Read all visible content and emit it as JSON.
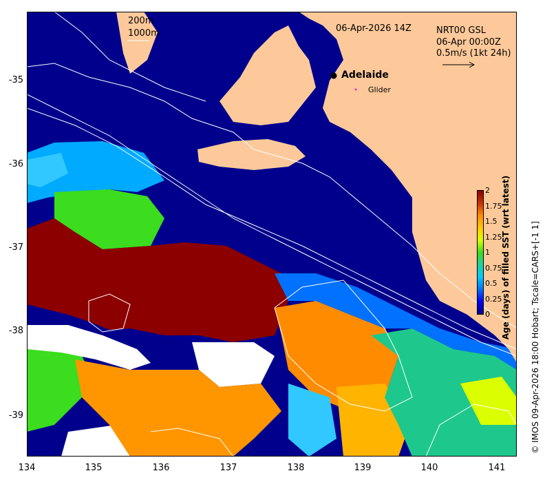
{
  "map": {
    "date_label": "06-Apr-2026 14Z",
    "product_label": "NRT00 GSL",
    "time_label": "06-Apr 00:00Z",
    "vector_scale_label": "0.5m/s (1kt 24h)",
    "isobath_labels": [
      "200m",
      "1000m"
    ],
    "city_label": "Adelaide",
    "glider_label": "Glider",
    "colors": {
      "land": "#fdc99a",
      "ocean_deep": "#00008c",
      "isobath": "#ffffff",
      "glider_marker": "#e040e0"
    }
  },
  "axes": {
    "x_ticks": [
      "134",
      "135",
      "136",
      "137",
      "138",
      "139",
      "140",
      "141"
    ],
    "y_ticks": [
      "-35",
      "-36",
      "-37",
      "-38",
      "-39"
    ],
    "x_range": [
      134,
      141.3
    ],
    "y_range": [
      -39.5,
      -34.2
    ]
  },
  "colorbar": {
    "label": "Age (days) of filled SST (wrt latest)",
    "ticks": [
      "2",
      "1.75",
      "1.5",
      "1.25",
      "1",
      "0.75",
      "0.5",
      "0.25",
      "0"
    ],
    "range": [
      0,
      2
    ],
    "colors": [
      "#00008c",
      "#0000ff",
      "#0072ff",
      "#00c8ff",
      "#1ed2a0",
      "#3cdc1e",
      "#dcff00",
      "#ffc800",
      "#ff8c00",
      "#c83200",
      "#8c0000"
    ]
  },
  "credit": "© IMOS 09-Apr-2026 18:00 Hobart; Tscale=CARS+[-1 1]"
}
